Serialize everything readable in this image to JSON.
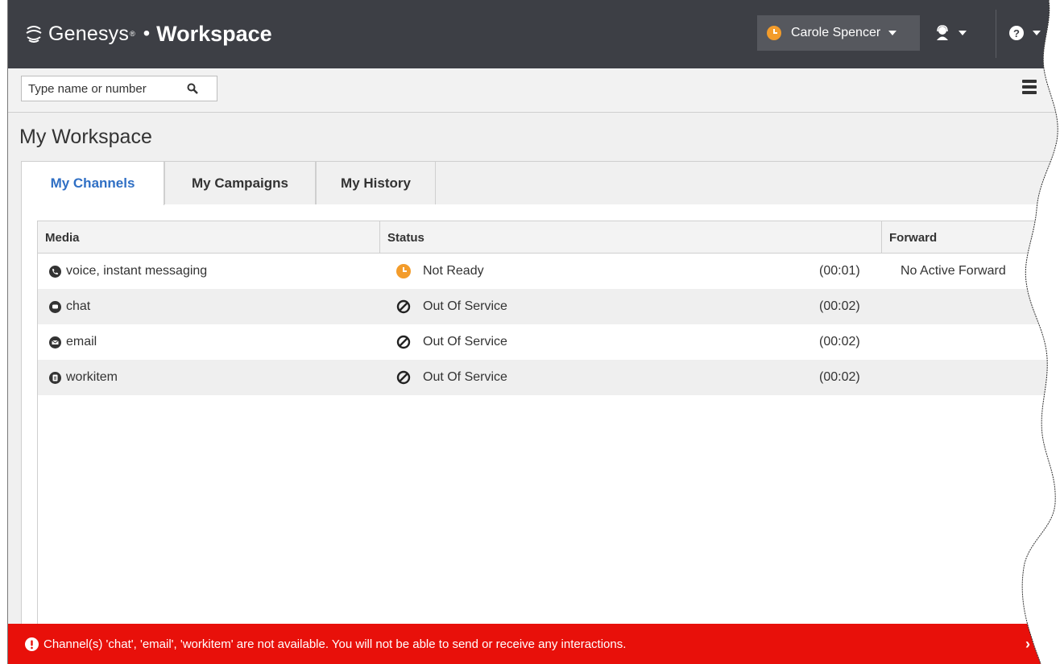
{
  "header": {
    "brand": "Genesys",
    "brand_mark": "®",
    "separator": "•",
    "product": "Workspace",
    "user_name": "Carole Spencer",
    "user_status_color": "#f39c2b",
    "agent_icon": "agent-headset-icon",
    "help_icon": "help-icon"
  },
  "search": {
    "placeholder": "Type name or number",
    "icon": "search-icon"
  },
  "menu_icon": "hamburger-menu-icon",
  "page": {
    "title": "My Workspace"
  },
  "tabs": [
    {
      "label": "My Channels",
      "active": true
    },
    {
      "label": "My Campaigns",
      "active": false
    },
    {
      "label": "My History",
      "active": false
    }
  ],
  "table": {
    "columns": [
      "Media",
      "Status",
      "Forward"
    ],
    "rows": [
      {
        "media": "voice, instant messaging",
        "media_icon": "voice-im-icon",
        "status": "Not Ready",
        "status_icon": "not-ready-clock-icon",
        "time": "(00:01)",
        "forward": "No Active Forward"
      },
      {
        "media": "chat",
        "media_icon": "chat-icon",
        "status": "Out Of Service",
        "status_icon": "out-of-service-icon",
        "time": "(00:02)",
        "forward": ""
      },
      {
        "media": "email",
        "media_icon": "email-icon",
        "status": "Out Of Service",
        "status_icon": "out-of-service-icon",
        "time": "(00:02)",
        "forward": ""
      },
      {
        "media": "workitem",
        "media_icon": "workitem-icon",
        "status": "Out Of Service",
        "status_icon": "out-of-service-icon",
        "time": "(00:02)",
        "forward": ""
      }
    ]
  },
  "banner": {
    "message": "Channel(s) 'chat', 'email', 'workitem' are not available. You will not be able to send or receive any interactions.",
    "color": "#e8100a",
    "icon": "alert-icon",
    "close": "›"
  },
  "colors": {
    "header_bg": "#3d3f45",
    "tab_active_text": "#2f6fc4",
    "not_ready": "#f39c2b"
  }
}
